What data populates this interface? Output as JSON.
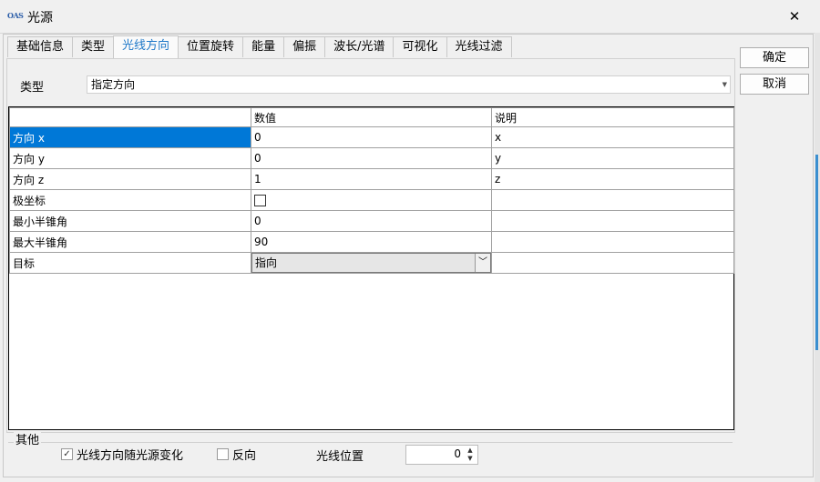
{
  "window": {
    "title": "光源",
    "icon_text": "OAS",
    "close": "✕"
  },
  "tabs": [
    {
      "label": "基础信息"
    },
    {
      "label": "类型"
    },
    {
      "label": "光线方向"
    },
    {
      "label": "位置旋转"
    },
    {
      "label": "能量"
    },
    {
      "label": "偏振"
    },
    {
      "label": "波长/光谱"
    },
    {
      "label": "可视化"
    },
    {
      "label": "光线过滤"
    }
  ],
  "active_tab": "光线方向",
  "type_field": {
    "label": "类型",
    "value": "指定方向"
  },
  "table": {
    "headers": [
      "",
      "数值",
      "说明"
    ],
    "rows": [
      {
        "name": "方向 x",
        "value": "0",
        "desc": "x"
      },
      {
        "name": "方向 y",
        "value": "0",
        "desc": "y"
      },
      {
        "name": "方向 z",
        "value": "1",
        "desc": "z"
      },
      {
        "name": "极坐标",
        "value": "",
        "desc": ""
      },
      {
        "name": "最小半锥角",
        "value": "0",
        "desc": ""
      },
      {
        "name": "最大半锥角",
        "value": "90",
        "desc": ""
      },
      {
        "name": "目标",
        "value": "指向",
        "desc": ""
      }
    ]
  },
  "other_group": {
    "title": "其他",
    "follow_source_label": "光线方向随光源变化",
    "follow_source_checked": true,
    "reverse_label": "反向",
    "reverse_checked": false,
    "ray_position_label": "光线位置",
    "ray_position_value": "0"
  },
  "buttons": {
    "ok": "确定",
    "cancel": "取消"
  },
  "colors": {
    "selection": "#0078d7",
    "active_tab_text": "#1e78c8",
    "accent_edge": "#3a8fd0"
  }
}
